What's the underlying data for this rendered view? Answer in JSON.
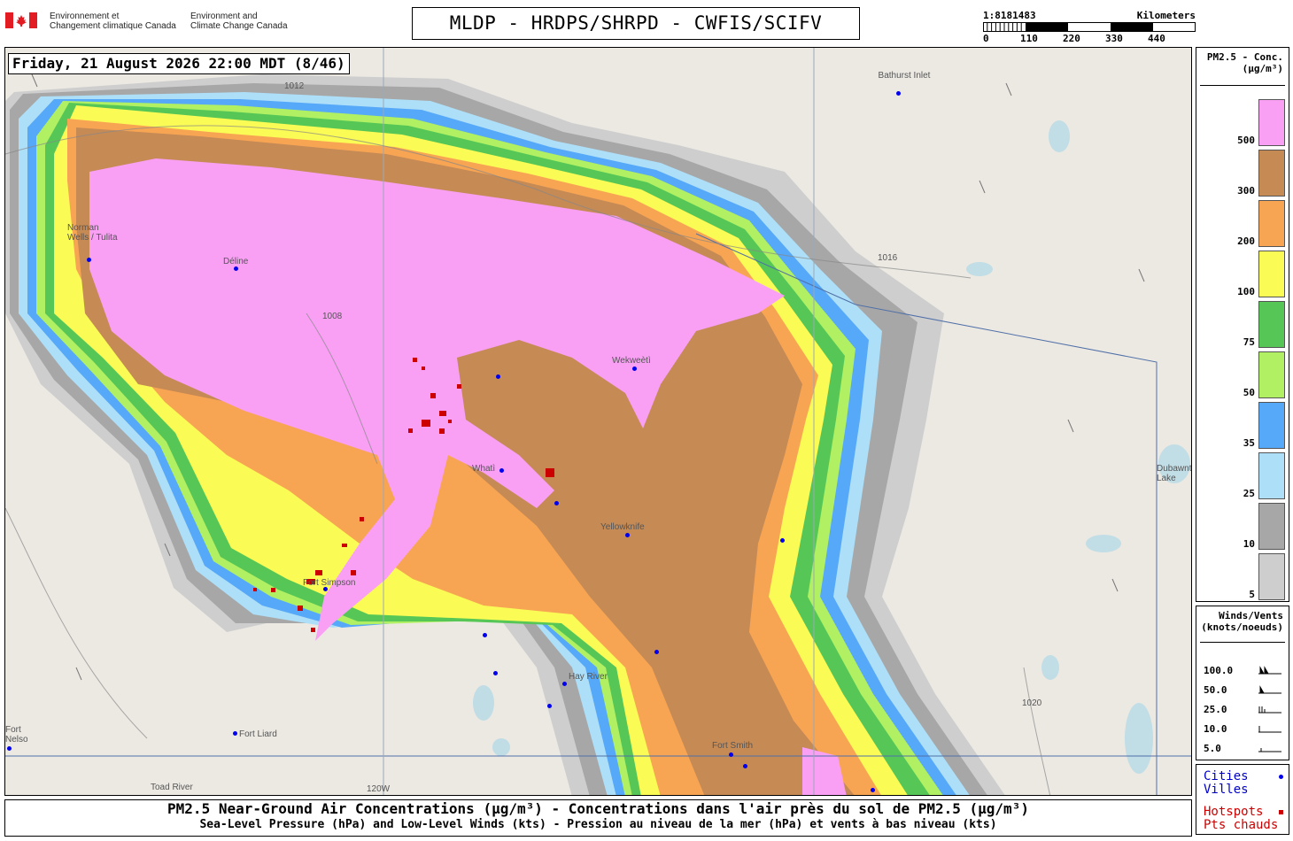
{
  "header": {
    "gov_fr_1": "Environnement et",
    "gov_fr_2": "Changement climatique Canada",
    "gov_en_1": "Environment and",
    "gov_en_2": "Climate Change Canada",
    "title": "MLDP - HRDPS/SHRPD - CWFIS/SCIFV"
  },
  "scale": {
    "ratio": "1:8181483",
    "unit": "Kilometers",
    "ticks": [
      "0",
      "110",
      "220",
      "330",
      "440"
    ]
  },
  "timestamp": "Friday, 21 August 2026 22:00 MDT (8/46)",
  "legend": {
    "title_1": "PM2.5 - Conc.",
    "title_2": "(µg/m³)",
    "levels": [
      {
        "label": "500",
        "color": "#f9a0f5"
      },
      {
        "label": "300",
        "color": "#c68a55"
      },
      {
        "label": "200",
        "color": "#f8a553"
      },
      {
        "label": "100",
        "color": "#fbfb55"
      },
      {
        "label": "75",
        "color": "#56c756"
      },
      {
        "label": "50",
        "color": "#b0f062"
      },
      {
        "label": "35",
        "color": "#56a8f8"
      },
      {
        "label": "25",
        "color": "#aedff8"
      },
      {
        "label": "10",
        "color": "#a7a7a7"
      },
      {
        "label": "5",
        "color": "#cecece"
      }
    ]
  },
  "wind_legend": {
    "title_1": "Winds/Vents",
    "title_2": "(knots/noeuds)",
    "rows": [
      "100.0",
      "50.0",
      "25.0",
      "10.0",
      "5.0"
    ]
  },
  "key_legend": {
    "cities_1": "Cities",
    "cities_2": "Villes",
    "hotspots_1": "Hotspots",
    "hotspots_2": "Pts chauds"
  },
  "footer": {
    "line1": "PM2.5 Near-Ground Air Concentrations (µg/m³) - Concentrations dans l'air près du sol de PM2.5 (µg/m³)",
    "line2": "Sea-Level Pressure (hPa) and Low-Level Winds (kts) - Pression au niveau de la mer (hPa) et vents à bas niveau (kts)"
  },
  "map": {
    "places": [
      "Bathurst Inlet",
      "Norman Wells / Tulita",
      "Déline",
      "Wekweètì",
      "Whatì",
      "Yellowknife",
      "Hay River",
      "Fort Liard",
      "Fort Smith",
      "Fort Simpson",
      "Dubawnt Lake",
      "Fort Nelson",
      "Toad River"
    ],
    "isobars": [
      "1012",
      "1008",
      "1016",
      "1020"
    ],
    "meridian": "120W"
  }
}
